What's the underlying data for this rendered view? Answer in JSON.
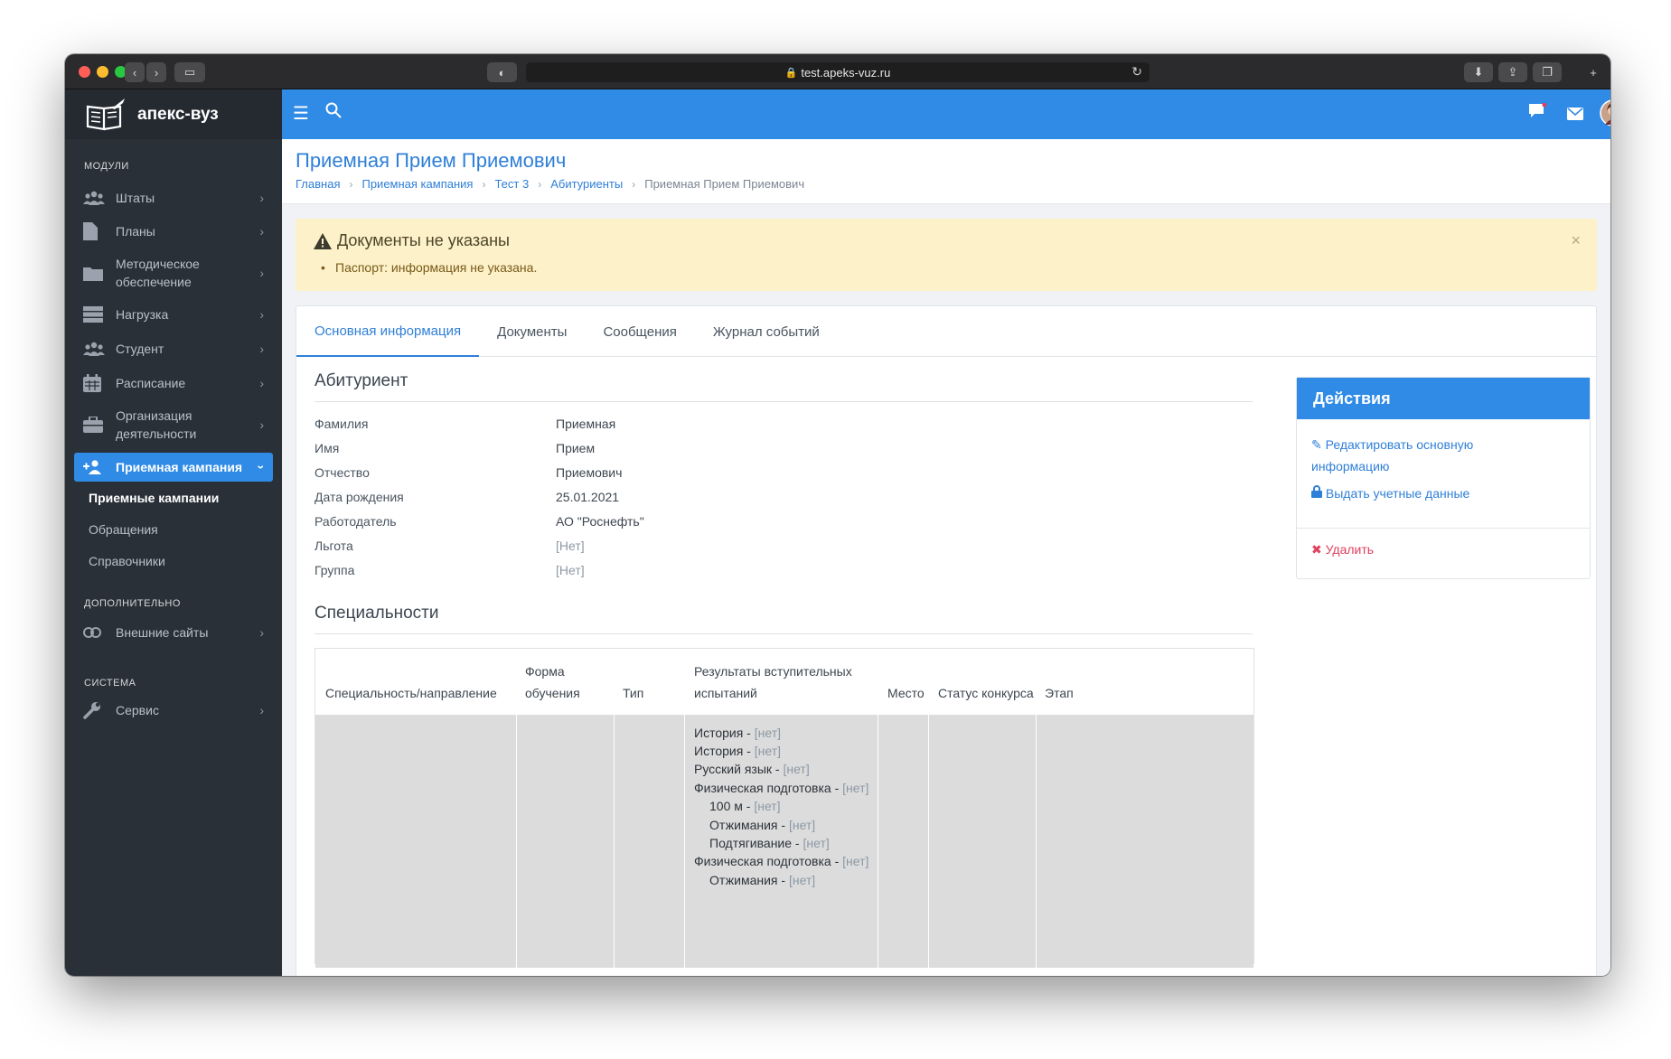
{
  "browser": {
    "url": "test.apeks-vuz.ru"
  },
  "sidebar": {
    "brand": "апекс-вуз",
    "sections": {
      "modules": "МОДУЛИ",
      "extra": "ДОПОЛНИТЕЛЬНО",
      "system": "СИСТЕМА"
    },
    "items": [
      {
        "label": "Штаты",
        "icon": "users-icon"
      },
      {
        "label": "Планы",
        "icon": "file-icon"
      },
      {
        "label": "Методическое обеспечение",
        "icon": "folder-icon"
      },
      {
        "label": "Нагрузка",
        "icon": "server-icon"
      },
      {
        "label": "Студент",
        "icon": "users-icon"
      },
      {
        "label": "Расписание",
        "icon": "calendar-icon"
      },
      {
        "label": "Организация деятельности",
        "icon": "briefcase-icon"
      },
      {
        "label": "Приемная кампания",
        "icon": "user-plus-icon"
      }
    ],
    "subitems": [
      "Приемные кампании",
      "Обращения",
      "Справочники"
    ],
    "extra_items": [
      {
        "label": "Внешние сайты",
        "icon": "link-icon"
      }
    ],
    "system_items": [
      {
        "label": "Сервис",
        "icon": "wrench-icon"
      }
    ]
  },
  "page": {
    "title": "Приемная Прием Приемович",
    "breadcrumbs": [
      "Главная",
      "Приемная кампания",
      "Тест 3",
      "Абитуриенты",
      "Приемная Прием Приемович"
    ]
  },
  "alert": {
    "title": "Документы не указаны",
    "item": "Паспорт: информация не указана.",
    "close": "×",
    "color": "#fcf1c8"
  },
  "tabs": [
    "Основная информация",
    "Документы",
    "Сообщения",
    "Журнал событий"
  ],
  "applicant": {
    "heading": "Абитуриент",
    "fields": [
      {
        "label": "Фамилия",
        "value": "Приемная"
      },
      {
        "label": "Имя",
        "value": "Прием"
      },
      {
        "label": "Отчество",
        "value": "Приемович"
      },
      {
        "label": "Дата рождения",
        "value": "25.01.2021"
      },
      {
        "label": "Работодатель",
        "value": "АО \"Роснефть\""
      },
      {
        "label": "Льгота",
        "value": "[Нет]"
      },
      {
        "label": "Группа",
        "value": "[Нет]"
      }
    ]
  },
  "specialties": {
    "heading": "Специальности",
    "columns": [
      "Специальность/направление",
      "Форма обучения",
      "Тип",
      "Результаты вступительных испытаний",
      "Место",
      "Статус конкурса",
      "Этап"
    ],
    "results": [
      {
        "name": "История",
        "value": "[нет]",
        "indent": false
      },
      {
        "name": "История",
        "value": "[нет]",
        "indent": false
      },
      {
        "name": "Русский язык",
        "value": "[нет]",
        "indent": false
      },
      {
        "name": "Физическая подготовка",
        "value": "[нет]",
        "indent": false
      },
      {
        "name": "100 м",
        "value": "[нет]",
        "indent": true
      },
      {
        "name": "Отжимания",
        "value": "[нет]",
        "indent": true
      },
      {
        "name": "Подтягивание",
        "value": "[нет]",
        "indent": true
      },
      {
        "name": "Физическая подготовка",
        "value": "[нет]",
        "indent": false
      },
      {
        "name": "Отжимания",
        "value": "[нет]",
        "indent": true
      }
    ]
  },
  "actions": {
    "title": "Действия",
    "edit": "Редактировать основную информацию",
    "credentials": "Выдать учетные данные",
    "delete": "Удалить"
  },
  "colors": {
    "accent": "#2f8be6",
    "sidebar": "#2a3038",
    "danger": "#e0415e"
  }
}
